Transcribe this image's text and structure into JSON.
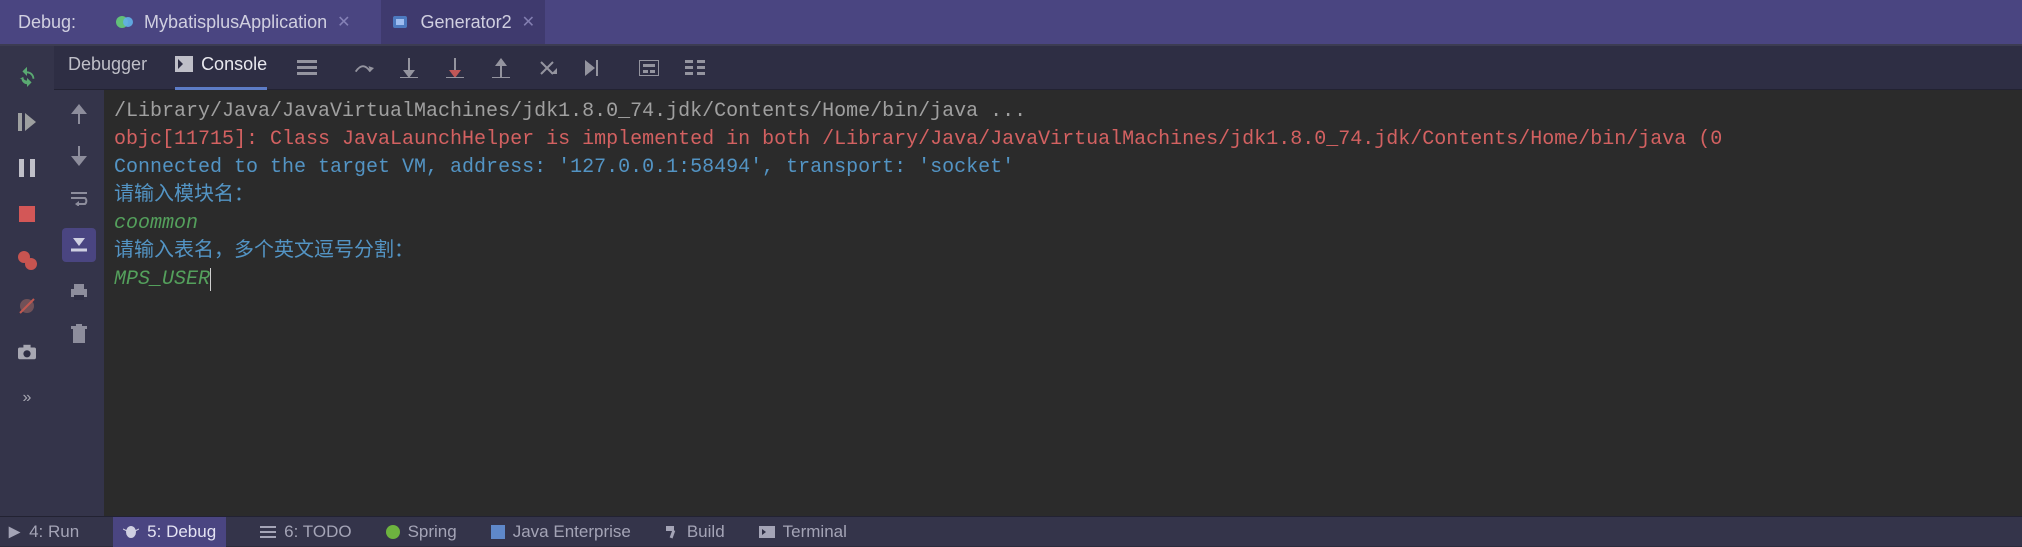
{
  "header": {
    "label": "Debug:",
    "tabs": [
      {
        "name": "MybatisplusApplication",
        "active": false
      },
      {
        "name": "Generator2",
        "active": true
      }
    ]
  },
  "toolbar": {
    "tabset": [
      {
        "label": "Debugger",
        "active": false
      },
      {
        "label": "Console",
        "active": true
      }
    ]
  },
  "console": {
    "lines": {
      "jvm": "/Library/Java/JavaVirtualMachines/jdk1.8.0_74.jdk/Contents/Home/bin/java ...",
      "objc": "objc[11715]: Class JavaLaunchHelper is implemented in both /Library/Java/JavaVirtualMachines/jdk1.8.0_74.jdk/Contents/Home/bin/java (0",
      "connected": "Connected to the target VM, address: '127.0.0.1:58494', transport: 'socket'",
      "prompt_module": "请输入模块名：",
      "input_module": "coommon",
      "prompt_table": "请输入表名，多个英文逗号分割：",
      "input_table": "MPS_USER"
    }
  },
  "bottom": {
    "items": {
      "run": "4: Run",
      "debug": "5: Debug",
      "todo": "6: TODO",
      "spring": "Spring",
      "jee": "Java Enterprise",
      "build": "Build",
      "terminal": "Terminal"
    }
  }
}
